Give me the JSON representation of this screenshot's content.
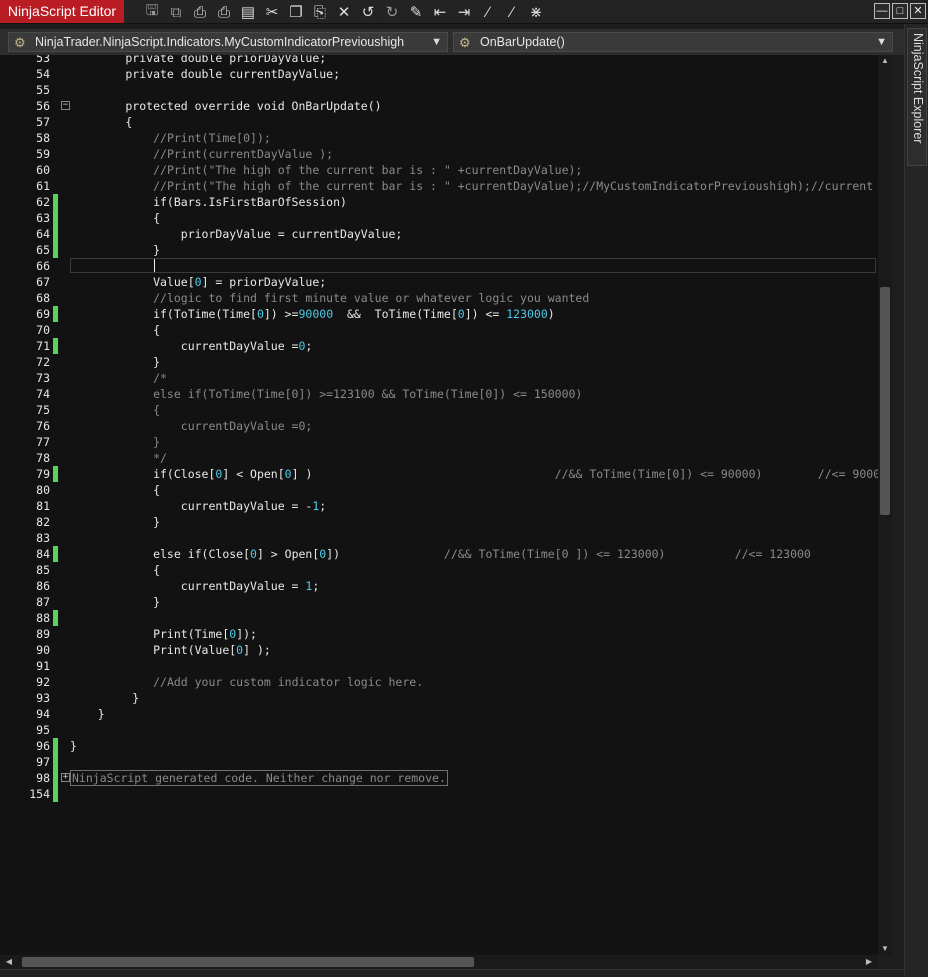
{
  "app": {
    "title": "NinjaScript Editor"
  },
  "toolbar": {
    "icons": [
      "save-icon",
      "save-all-icon",
      "print-icon",
      "print-preview-icon",
      "list-icon",
      "cut-icon",
      "copy-icon",
      "paste-icon",
      "delete-icon",
      "undo-icon",
      "redo-icon",
      "compile-icon",
      "indent-icon",
      "outdent-icon",
      "comment-icon",
      "uncomment-icon",
      "visual-studio-icon"
    ]
  },
  "combos": {
    "class_selector": "NinjaTrader.NinjaScript.Indicators.MyCustomIndicatorPrevioushigh",
    "member_selector": "OnBarUpdate()"
  },
  "side_panel": {
    "tab_label": "NinjaScript Explorer"
  },
  "editor": {
    "lines": [
      {
        "n": "53",
        "t": "        private double priorDayValue;"
      },
      {
        "n": "54",
        "t": "        private double currentDayValue;"
      },
      {
        "n": "55",
        "t": ""
      },
      {
        "n": "56",
        "t": "        protected override void OnBarUpdate()"
      },
      {
        "n": "57",
        "t": "        {"
      },
      {
        "n": "58",
        "t": "            //Print(Time[0]);"
      },
      {
        "n": "59",
        "t": "            //Print(currentDayValue );"
      },
      {
        "n": "60",
        "t": "            //Print(\"The high of the current bar is : \" +currentDayValue);"
      },
      {
        "n": "61",
        "t": "            //Print(\"The high of the current bar is : \" +currentDayValue);//MyCustomIndicatorPrevioushigh);//current"
      },
      {
        "n": "62",
        "t": "            if(Bars.IsFirstBarOfSession)"
      },
      {
        "n": "63",
        "t": "            {"
      },
      {
        "n": "64",
        "t": "                priorDayValue = currentDayValue;"
      },
      {
        "n": "65",
        "t": "            }"
      },
      {
        "n": "66",
        "t": ""
      },
      {
        "n": "67",
        "t": "            Value[0] = priorDayValue;"
      },
      {
        "n": "68",
        "t": "            //logic to find first minute value or whatever logic you wanted"
      },
      {
        "n": "69",
        "t": "            if(ToTime(Time[0]) >=90000  &&  ToTime(Time[0]) <= 123000)"
      },
      {
        "n": "70",
        "t": "            {"
      },
      {
        "n": "71",
        "t": "                currentDayValue =0;"
      },
      {
        "n": "72",
        "t": "            }"
      },
      {
        "n": "73",
        "t": "            /*"
      },
      {
        "n": "74",
        "t": "            else if(ToTime(Time[0]) >=123100 && ToTime(Time[0]) <= 150000)"
      },
      {
        "n": "75",
        "t": "            {"
      },
      {
        "n": "76",
        "t": "                currentDayValue =0;"
      },
      {
        "n": "77",
        "t": "            }"
      },
      {
        "n": "78",
        "t": "            */"
      },
      {
        "n": "79",
        "t": "            if(Close[0] < Open[0] )                                   //&& ToTime(Time[0]) <= 90000)        //<= 9000"
      },
      {
        "n": "80",
        "t": "            {"
      },
      {
        "n": "81",
        "t": "                currentDayValue = -1;"
      },
      {
        "n": "82",
        "t": "            }"
      },
      {
        "n": "83",
        "t": ""
      },
      {
        "n": "84",
        "t": "            else if(Close[0] > Open[0])               //&& ToTime(Time[0 ]) <= 123000)          //<= 123000"
      },
      {
        "n": "85",
        "t": "            {"
      },
      {
        "n": "86",
        "t": "                currentDayValue = 1;"
      },
      {
        "n": "87",
        "t": "            }"
      },
      {
        "n": "88",
        "t": ""
      },
      {
        "n": "89",
        "t": "            Print(Time[0]);"
      },
      {
        "n": "90",
        "t": "            Print(Value[0] );"
      },
      {
        "n": "91",
        "t": ""
      },
      {
        "n": "92",
        "t": "            //Add your custom indicator logic here."
      },
      {
        "n": "93",
        "t": "         }"
      },
      {
        "n": "94",
        "t": "    }"
      },
      {
        "n": "95",
        "t": ""
      },
      {
        "n": "96",
        "t": "}"
      },
      {
        "n": "97",
        "t": ""
      },
      {
        "n": "98",
        "t": "NinjaScript generated code. Neither change nor remove."
      },
      {
        "n": "154",
        "t": ""
      }
    ]
  },
  "colors": {
    "accent": "#b91c22",
    "change_marker": "#5cd15c",
    "comment": "#8a8a8a",
    "number": "#4ec9e8",
    "background": "#121212"
  }
}
